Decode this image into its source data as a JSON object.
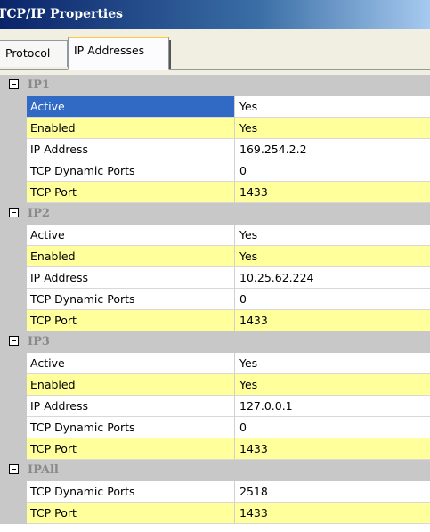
{
  "window": {
    "title": "TCP/IP Properties"
  },
  "tabs": [
    {
      "label": "Protocol",
      "active": false
    },
    {
      "label": "IP Addresses",
      "active": true
    }
  ],
  "colors": {
    "highlight": "#ffff9c",
    "selection": "#316ac5",
    "group_bg": "#c8c8c8"
  },
  "groups": [
    {
      "label": "IP1",
      "rows": [
        {
          "name": "Active",
          "value": "Yes",
          "style": "selected"
        },
        {
          "name": "Enabled",
          "value": "Yes",
          "style": "hl"
        },
        {
          "name": "IP Address",
          "value": "169.254.2.2",
          "style": ""
        },
        {
          "name": "TCP Dynamic Ports",
          "value": "0",
          "style": ""
        },
        {
          "name": "TCP Port",
          "value": "1433",
          "style": "hl"
        }
      ]
    },
    {
      "label": "IP2",
      "rows": [
        {
          "name": "Active",
          "value": "Yes",
          "style": ""
        },
        {
          "name": "Enabled",
          "value": "Yes",
          "style": "hl"
        },
        {
          "name": "IP Address",
          "value": "10.25.62.224",
          "style": ""
        },
        {
          "name": "TCP Dynamic Ports",
          "value": "0",
          "style": ""
        },
        {
          "name": "TCP Port",
          "value": "1433",
          "style": "hl"
        }
      ]
    },
    {
      "label": "IP3",
      "rows": [
        {
          "name": "Active",
          "value": "Yes",
          "style": ""
        },
        {
          "name": "Enabled",
          "value": "Yes",
          "style": "hl"
        },
        {
          "name": "IP Address",
          "value": "127.0.0.1",
          "style": ""
        },
        {
          "name": "TCP Dynamic Ports",
          "value": "0",
          "style": ""
        },
        {
          "name": "TCP Port",
          "value": "1433",
          "style": "hl"
        }
      ]
    },
    {
      "label": "IPAll",
      "rows": [
        {
          "name": "TCP Dynamic Ports",
          "value": "2518",
          "style": ""
        },
        {
          "name": "TCP Port",
          "value": "1433",
          "style": "hl"
        }
      ]
    }
  ]
}
